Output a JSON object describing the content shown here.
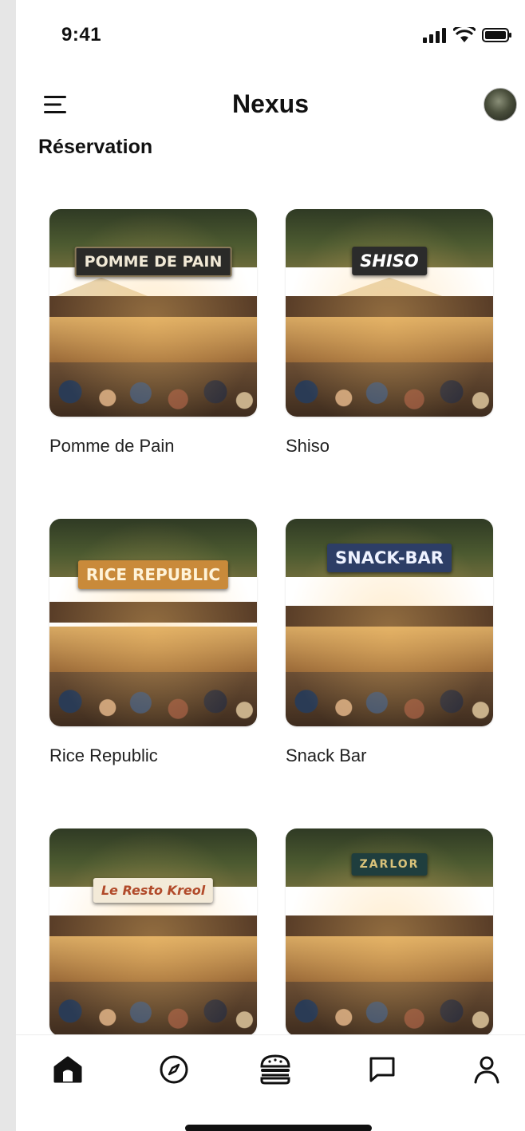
{
  "status_bar": {
    "time": "9:41"
  },
  "header": {
    "title": "Nexus"
  },
  "section": {
    "title": "Réservation"
  },
  "restaurants": [
    {
      "name": "Pomme de Pain",
      "sign": "POMME DE PAIN"
    },
    {
      "name": "Shiso",
      "sign": "SHISO"
    },
    {
      "name": "Rice Republic",
      "sign": "RICE REPUBLIC"
    },
    {
      "name": "Snack Bar",
      "sign": "SNACK-BAR"
    },
    {
      "name": "",
      "sign": "Le Resto Kreol"
    },
    {
      "name": "",
      "sign": "ZARLOR"
    }
  ],
  "tabs": [
    {
      "icon": "home-icon",
      "active": true
    },
    {
      "icon": "compass-icon",
      "active": false
    },
    {
      "icon": "burger-icon",
      "active": false
    },
    {
      "icon": "chat-icon",
      "active": false
    },
    {
      "icon": "profile-icon",
      "active": false
    }
  ],
  "colors": {
    "text": "#111111",
    "background": "#ffffff",
    "frame": "#e6e6e6"
  }
}
